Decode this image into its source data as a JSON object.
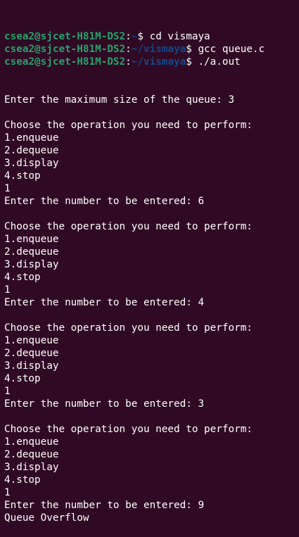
{
  "prompts": [
    {
      "user_host": "csea2@sjcet-H81M-DS2",
      "path": "~",
      "command": "cd vismaya"
    },
    {
      "user_host": "csea2@sjcet-H81M-DS2",
      "path": "~/vismaya",
      "command": "gcc queue.c"
    },
    {
      "user_host": "csea2@sjcet-H81M-DS2",
      "path": "~/vismaya",
      "command": "./a.out"
    }
  ],
  "output": [
    "Enter the maximum size of the queue: 3",
    "",
    "Choose the operation you need to perform:",
    "1.enqueue",
    "2.dequeue",
    "3.display",
    "4.stop",
    "1",
    "Enter the number to be entered: 6",
    "",
    "Choose the operation you need to perform:",
    "1.enqueue",
    "2.dequeue",
    "3.display",
    "4.stop",
    "1",
    "Enter the number to be entered: 4",
    "",
    "Choose the operation you need to perform:",
    "1.enqueue",
    "2.dequeue",
    "3.display",
    "4.stop",
    "1",
    "Enter the number to be entered: 3",
    "",
    "Choose the operation you need to perform:",
    "1.enqueue",
    "2.dequeue",
    "3.display",
    "4.stop",
    "1",
    "Enter the number to be entered: 9",
    "Queue Overflow"
  ],
  "colors": {
    "background": "#300a24",
    "user_host": "#26a269",
    "path": "#12488b",
    "text": "#ffffff"
  }
}
